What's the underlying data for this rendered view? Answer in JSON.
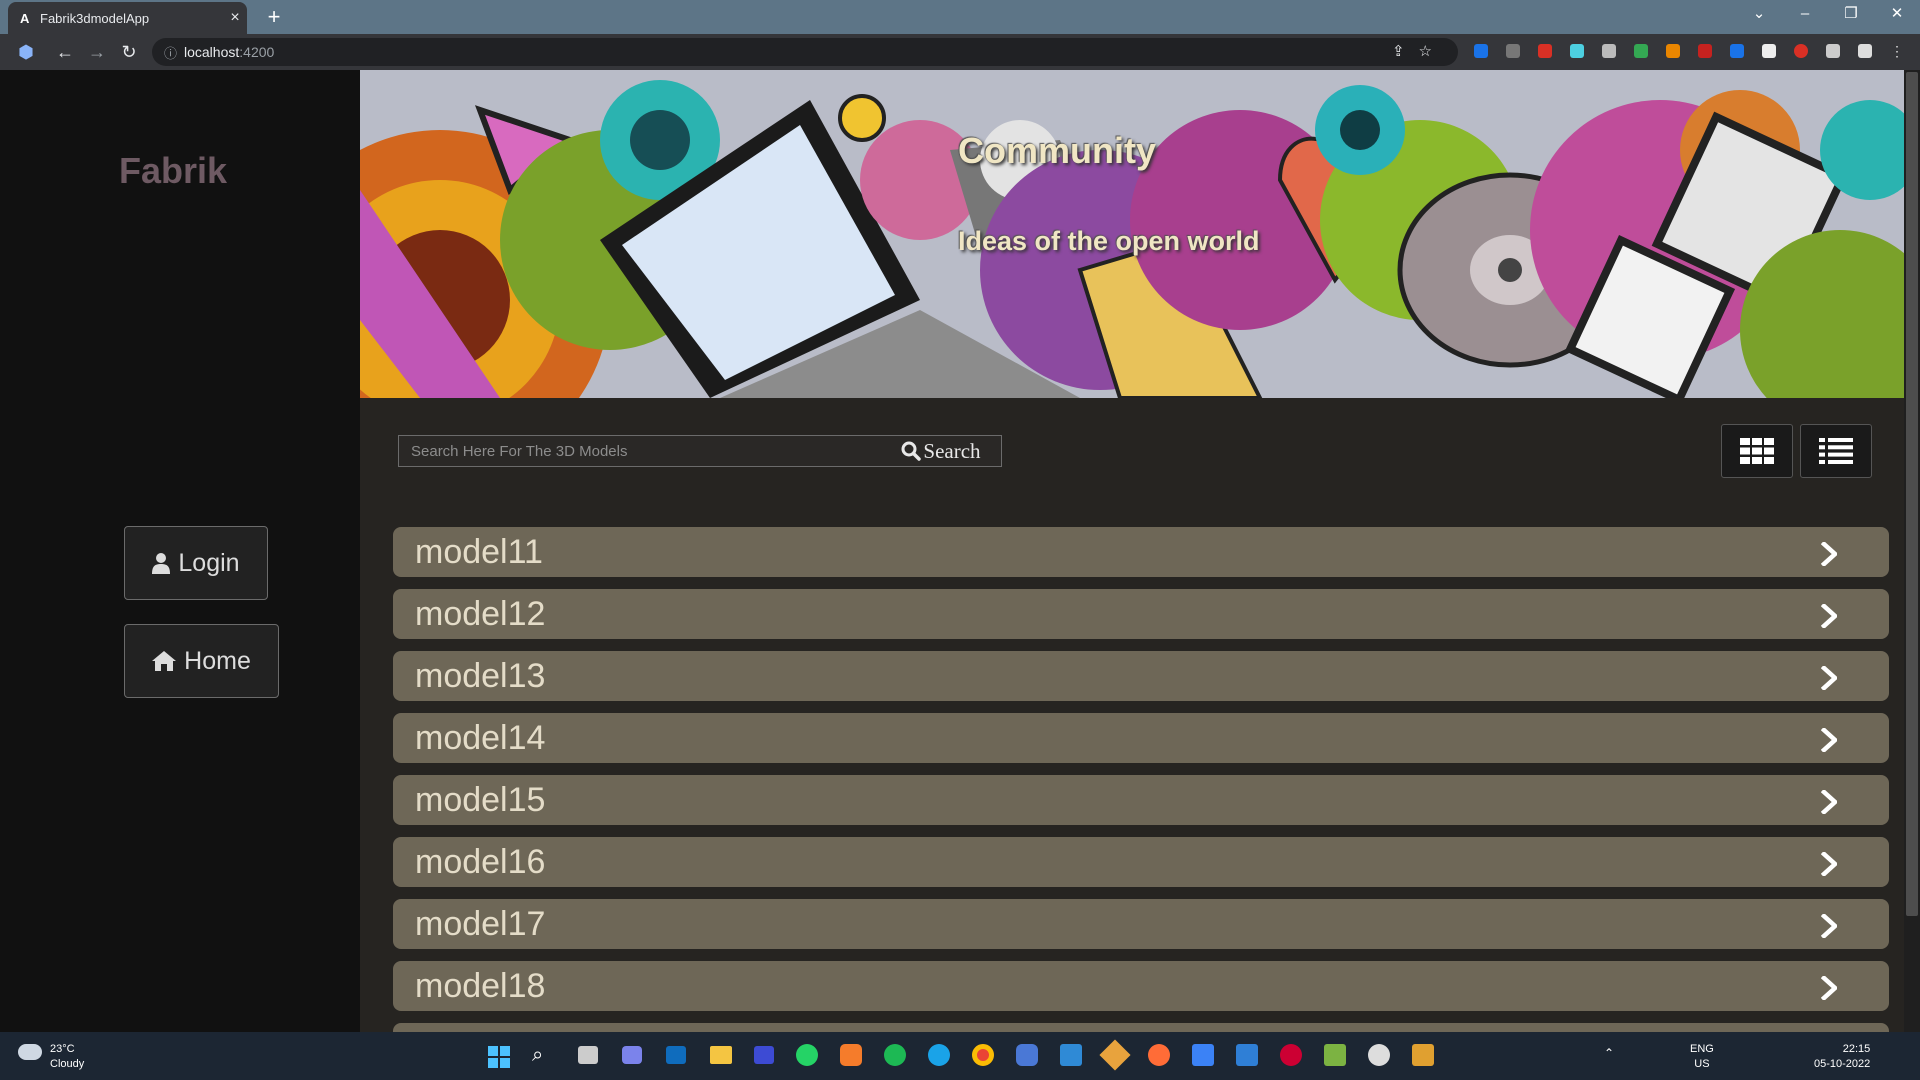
{
  "browser": {
    "tab_title": "Fabrik3dmodelApp",
    "tab_favicon": "A",
    "close_glyph": "×",
    "new_tab_glyph": "+",
    "url_host": "localhost",
    "url_port": ":4200"
  },
  "sidebar": {
    "brand": "Fabrik",
    "login_label": "Login",
    "home_label": "Home"
  },
  "banner": {
    "title": "Community",
    "subtitle": "Ideas of the open world"
  },
  "search": {
    "placeholder": "Search Here For The 3D Models",
    "button_label": "Search"
  },
  "models": [
    "model11",
    "model12",
    "model13",
    "model14",
    "model15",
    "model16",
    "model17",
    "model18"
  ],
  "colors": {
    "sidebar_bg": "#111111",
    "main_bg": "#262421",
    "row_bg": "#6e6757",
    "brand_color": "#6e5a63"
  }
}
